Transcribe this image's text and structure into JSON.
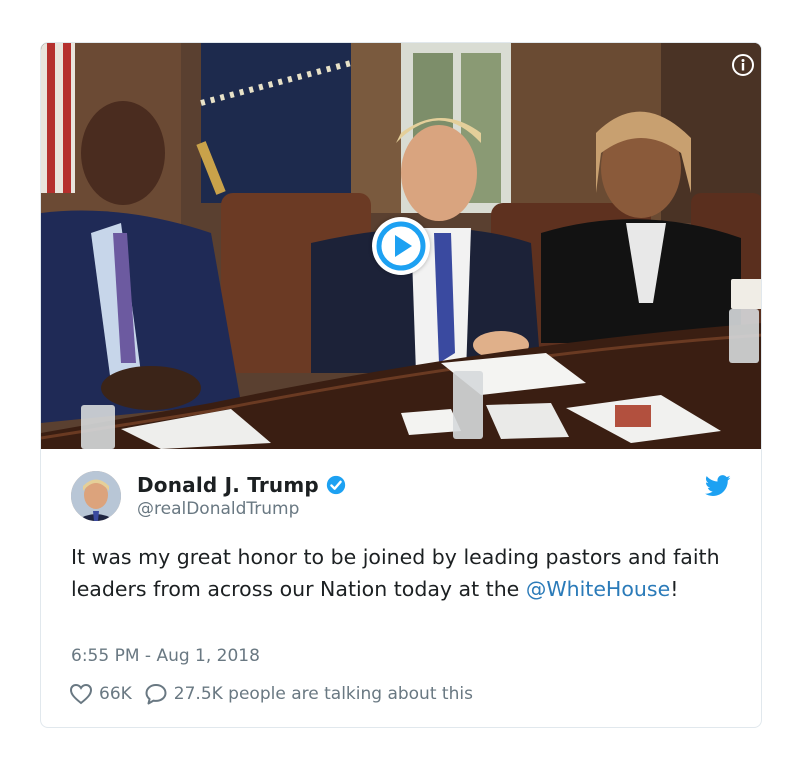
{
  "media": {
    "play_icon": "play-icon",
    "info_icon": "info-icon"
  },
  "tweet": {
    "display_name": "Donald J. Trump",
    "handle": "@realDonaldTrump",
    "verified_icon": "verified-badge-icon",
    "brand_icon": "twitter-bird-icon",
    "text_before_mention": "It was my great honor to be joined by leading pastors and faith leaders from across our Nation today at the ",
    "mention": "@WhiteHouse",
    "text_after_mention": "!",
    "timestamp": "6:55 PM - Aug 1, 2018",
    "likes": "66K",
    "like_icon": "heart-icon",
    "replies_label": "27.5K people are talking about this",
    "reply_icon": "speech-bubble-icon"
  },
  "colors": {
    "link": "#2b7bb9",
    "secondary_text": "#697882",
    "verified": "#1da1f2",
    "border": "#e1e8ed"
  }
}
